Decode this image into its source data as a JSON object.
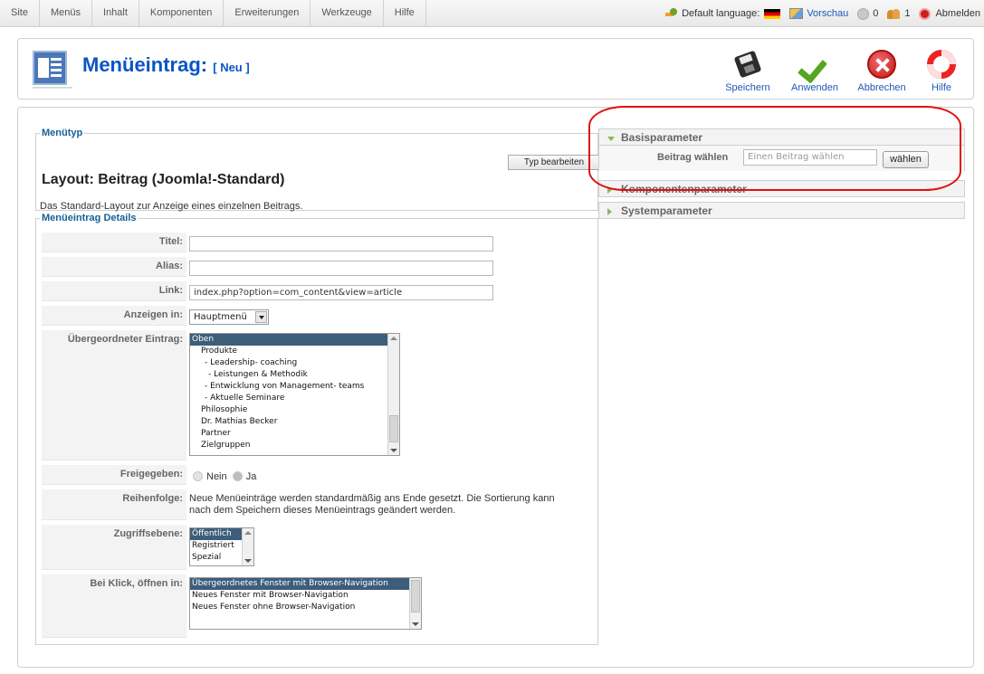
{
  "topmenu": [
    "Site",
    "Menüs",
    "Inhalt",
    "Komponenten",
    "Erweiterungen",
    "Werkzeuge",
    "Hilfe"
  ],
  "status": {
    "default_language_label": "Default language:",
    "preview_label": "Vorschau",
    "messages_count": "0",
    "users_count": "1",
    "logout_label": "Abmelden"
  },
  "header": {
    "title": "Menüeintrag:",
    "subtitle": "[ Neu ]"
  },
  "toolbar": {
    "save_label": "Speichern",
    "apply_label": "Anwenden",
    "cancel_label": "Abbrechen",
    "help_label": "Hilfe"
  },
  "menutype": {
    "legend": "Menütyp",
    "edit_type_button": "Typ bearbeiten",
    "layout_title": "Layout: Beitrag (Joomla!-Standard)",
    "layout_description": "Das Standard-Layout zur Anzeige eines einzelnen Beitrags."
  },
  "details": {
    "legend": "Menüeintrag Details",
    "title_label": "Titel:",
    "title_value": "",
    "alias_label": "Alias:",
    "alias_value": "",
    "link_label": "Link:",
    "link_value": "index.php?option=com_content&view=article",
    "display_in_label": "Anzeigen in:",
    "display_in_value": "Hauptmenü",
    "parent_label": "Übergeordneter Eintrag:",
    "parent_items": [
      "Oben",
      "Produkte",
      "- Leadership- coaching",
      "- Leistungen & Methodik",
      "- Entwicklung von Management- teams",
      "- Aktuelle Seminare",
      "Philosophie",
      "Dr. Mathias Becker",
      "Partner",
      "Zielgruppen"
    ],
    "parent_selected": "Oben",
    "published_label": "Freigegeben:",
    "published_no": "Nein",
    "published_yes": "Ja",
    "order_label": "Reihenfolge:",
    "order_text_line1": "Neue Menüeinträge werden standardmäßig ans Ende gesetzt. Die Sortierung kann",
    "order_text_line2": "nach dem Speichern dieses Menüeintrags geändert werden.",
    "access_label": "Zugriffsebene:",
    "access_options": [
      "Öffentlich",
      "Registriert",
      "Spezial"
    ],
    "access_selected": "Öffentlich",
    "onclick_label": "Bei Klick, öffnen in:",
    "onclick_options": [
      "Übergeordnetes Fenster mit Browser-Navigation",
      "Neues Fenster mit Browser-Navigation",
      "Neues Fenster ohne Browser-Navigation"
    ],
    "onclick_selected": "Übergeordnetes Fenster mit Browser-Navigation"
  },
  "panels": {
    "basic_title": "Basisparameter",
    "article_label": "Beitrag wählen",
    "article_placeholder": "Einen Beitrag wählen",
    "choose_button": "wählen",
    "component_title": "Komponentenparameter",
    "system_title": "Systemparameter"
  },
  "colors": {
    "title_blue": "#0b55c4",
    "legend_blue": "#146295",
    "highlight_red": "#e01010",
    "selected_option": "#3c5e7a"
  }
}
